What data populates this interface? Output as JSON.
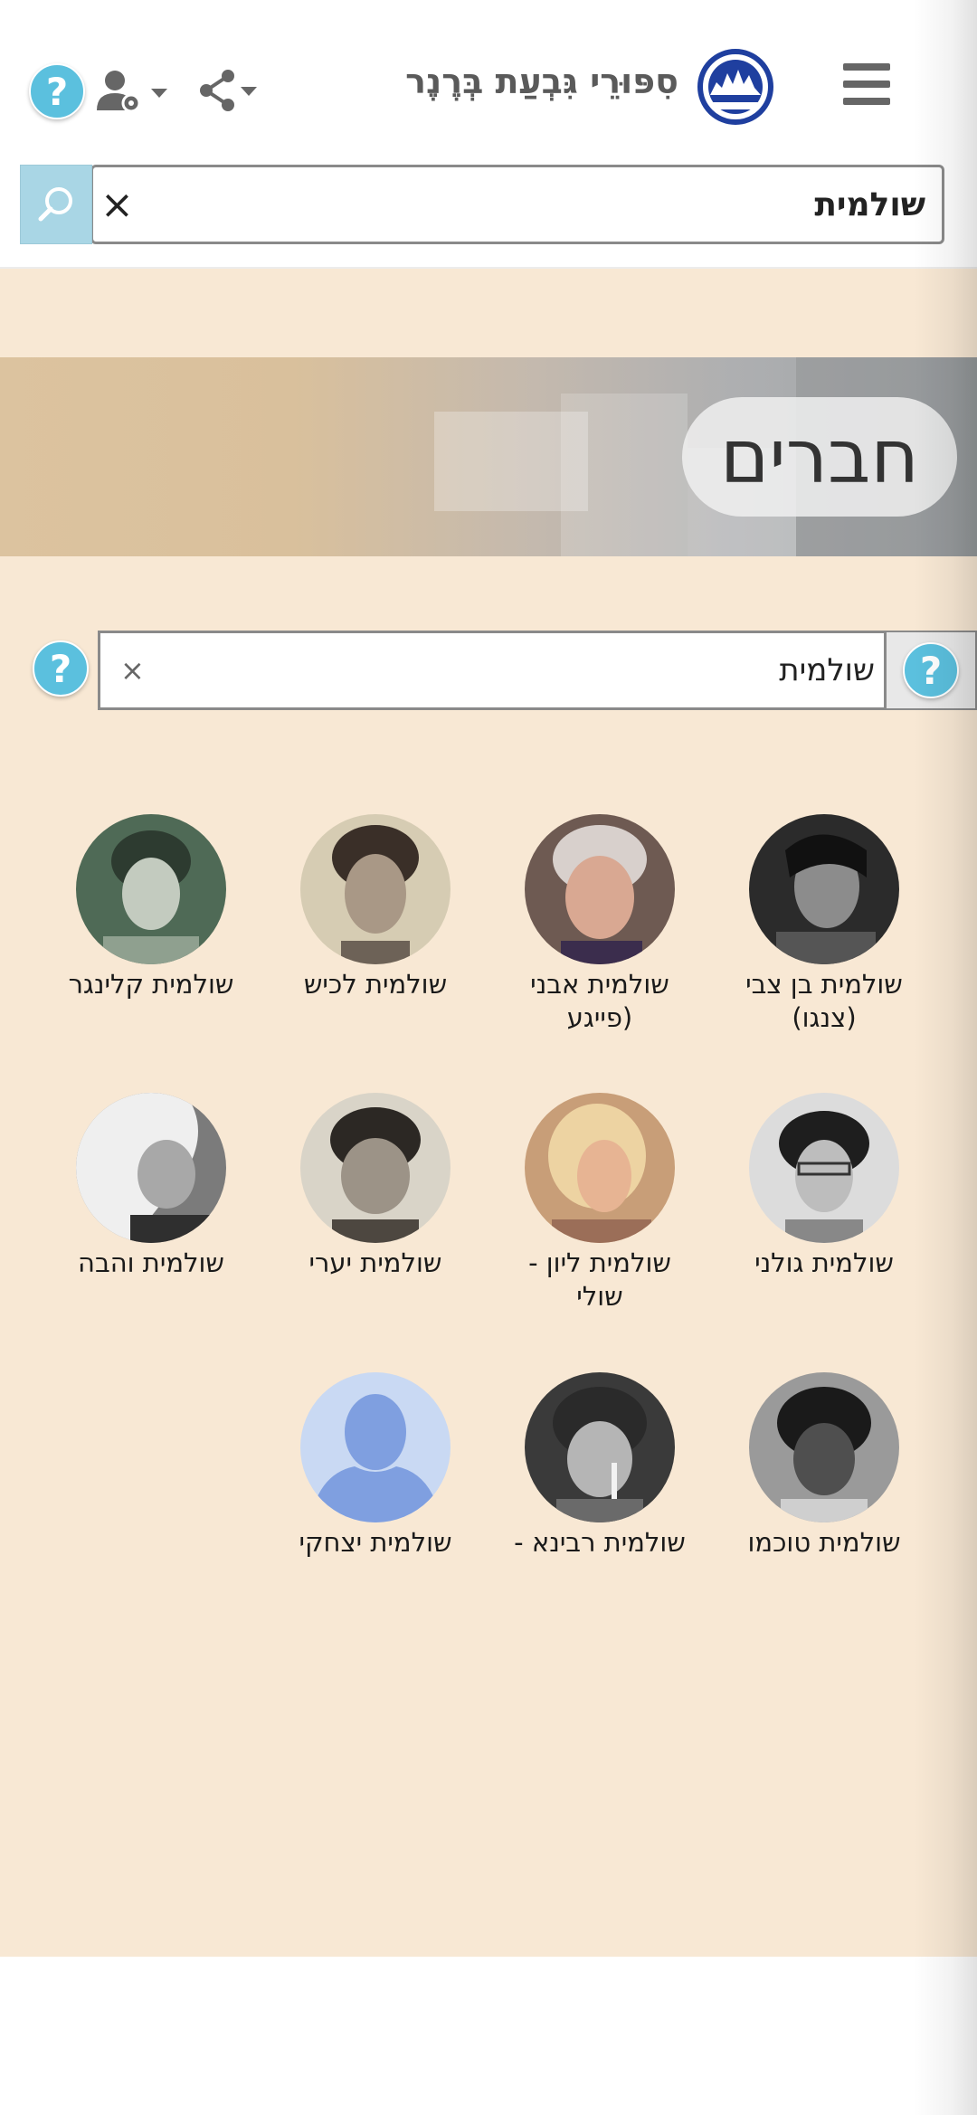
{
  "header": {
    "site_title": "סִפּוּרֵי גִּבְעַת בְּרֶנֶר",
    "help_symbol": "?"
  },
  "top_search": {
    "value": "שולמית",
    "clear_symbol": "×"
  },
  "banner": {
    "title": "חברים"
  },
  "filter": {
    "value": "שולמית",
    "clear_symbol": "×",
    "help_symbol": "?"
  },
  "members": [
    {
      "name": "שולמית בן צבי (צנגו)",
      "avatar_color": "#2b2b2b"
    },
    {
      "name": "שולמית אבני (פייגע",
      "avatar_color": "#8a6f62"
    },
    {
      "name": "שולמית לכיש",
      "avatar_color": "#a69c88"
    },
    {
      "name": "שולמית קלינגר",
      "avatar_color": "#55705c"
    },
    {
      "name": "שולמית גולני",
      "avatar_color": "#9a9a9a"
    },
    {
      "name": "שולמית ליון - שולי",
      "avatar_color": "#d8b68e"
    },
    {
      "name": "שולמית יערי",
      "avatar_color": "#6f6a62"
    },
    {
      "name": "שולמית והבה",
      "avatar_color": "#bfbfbf"
    },
    {
      "name": "שולמית טוכמו",
      "avatar_color": "#4a4a4a"
    },
    {
      "name": "שולמית רבינא -",
      "avatar_color": "#5a5a5a"
    },
    {
      "name": "שולמית יצחקי",
      "avatar_color": "#c9d9f3"
    }
  ],
  "colors": {
    "accent_help": "#5bc0de",
    "panel_bg": "#f8e8d4",
    "search_btn": "#a9d6e5"
  },
  "icons": [
    "menu-icon",
    "site-logo-icon",
    "share-icon",
    "user-settings-icon",
    "help-icon",
    "search-icon",
    "close-icon"
  ]
}
